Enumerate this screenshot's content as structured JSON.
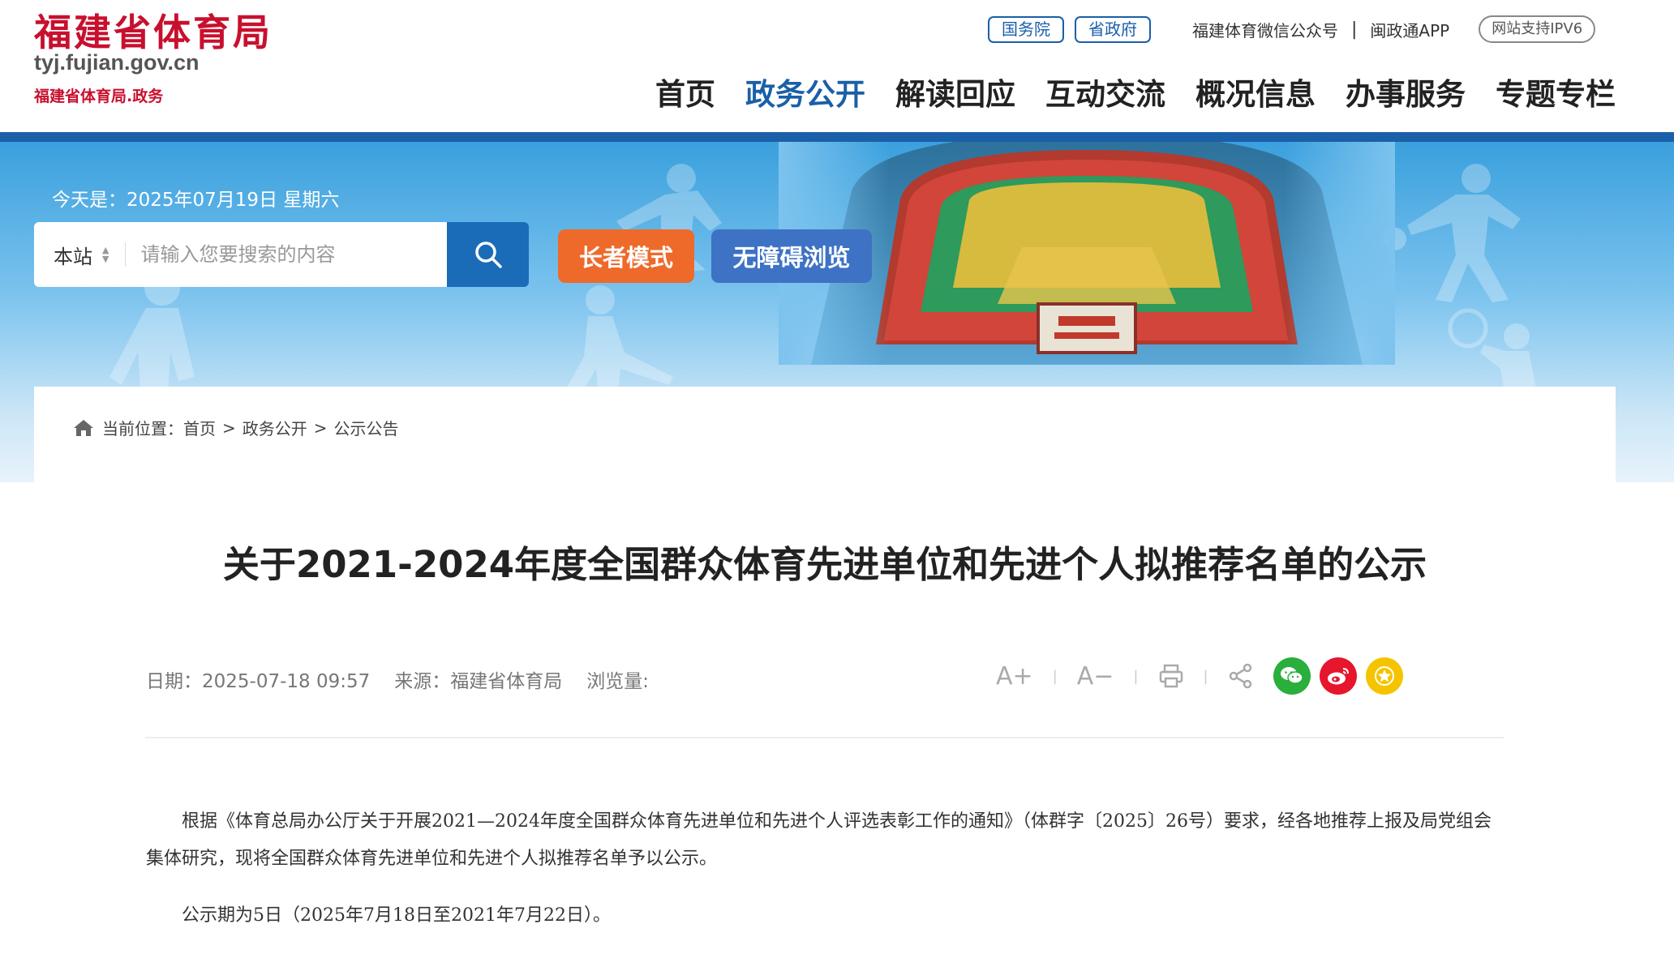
{
  "header": {
    "logo_title": "福建省体育局",
    "logo_domain": "tyj.fujian.gov.cn",
    "logo_sub": "福建省体育局.政务",
    "top_links": {
      "state_council": "国务院",
      "province_gov": "省政府",
      "wechat": "福建体育微信公众号",
      "separator": "|",
      "app": "闽政通APP",
      "ipv6": "网站支持IPV6"
    },
    "nav": [
      {
        "label": "首页"
      },
      {
        "label": "政务公开"
      },
      {
        "label": "解读回应"
      },
      {
        "label": "互动交流"
      },
      {
        "label": "概况信息"
      },
      {
        "label": "办事服务"
      },
      {
        "label": "专题专栏"
      }
    ],
    "active_nav": "政务公开"
  },
  "banner": {
    "date_text": "今天是：2025年07月19日 星期六",
    "search": {
      "scope": "本站",
      "placeholder": "请输入您要搜索的内容"
    },
    "elder_mode": "长者模式",
    "accessibility": "无障碍浏览"
  },
  "breadcrumb": {
    "prefix": "当前位置：",
    "items": [
      "首页",
      "政务公开",
      "公示公告"
    ],
    "sep": ">"
  },
  "article": {
    "title": "关于2021-2024年度全国群众体育先进单位和先进个人拟推荐名单的公示",
    "date": "日期：2025-07-18 09:57",
    "source": "来源：福建省体育局",
    "views": "浏览量:",
    "tools": {
      "font_up": "A+",
      "font_down": "A−"
    },
    "paragraphs": [
      "根据《体育总局办公厅关于开展2021—2024年度全国群众体育先进单位和先进个人评选表彰工作的通知》（体群字〔2025〕26号）要求，经各地推荐上报及局党组会集体研究，现将全国群众体育先进单位和先进个人拟推荐名单予以公示。",
      "公示期为5日（2025年7月18日至2021年7月22日）。"
    ]
  },
  "colors": {
    "brand_red": "#c8102e",
    "brand_blue": "#1a5fa8",
    "elder_orange": "#ee6a2a",
    "access_blue": "#3e72c4",
    "wechat_green": "#2aae3c",
    "weibo_red": "#e6162d",
    "star_yellow": "#f5c400"
  }
}
